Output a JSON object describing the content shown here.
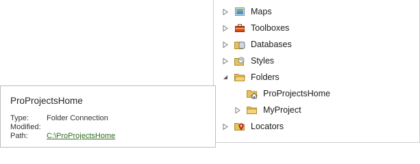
{
  "tree": {
    "items": [
      {
        "label": "Maps",
        "icon": "map-icon",
        "expander": "collapsed"
      },
      {
        "label": "Toolboxes",
        "icon": "toolbox-icon",
        "expander": "collapsed"
      },
      {
        "label": "Databases",
        "icon": "database-icon",
        "expander": "collapsed"
      },
      {
        "label": "Styles",
        "icon": "style-icon",
        "expander": "collapsed"
      },
      {
        "label": "Folders",
        "icon": "folder-open-icon",
        "expander": "expanded"
      },
      {
        "label": "ProProjectsHome",
        "icon": "folder-home-icon",
        "expander": "none"
      },
      {
        "label": "MyProject",
        "icon": "folder-icon",
        "expander": "collapsed"
      },
      {
        "label": "Locators",
        "icon": "locator-icon",
        "expander": "collapsed"
      }
    ]
  },
  "tooltip": {
    "title": "ProProjectsHome",
    "type_key": "Type:",
    "type_value": "Folder Connection",
    "modified_key": "Modified:",
    "modified_value": "",
    "path_key": "Path:",
    "path_value": "C:\\ProProjectsHome"
  },
  "colors": {
    "folder": "#e8c15a",
    "link": "#2e6b1e",
    "expander": "#7a7a7a"
  }
}
